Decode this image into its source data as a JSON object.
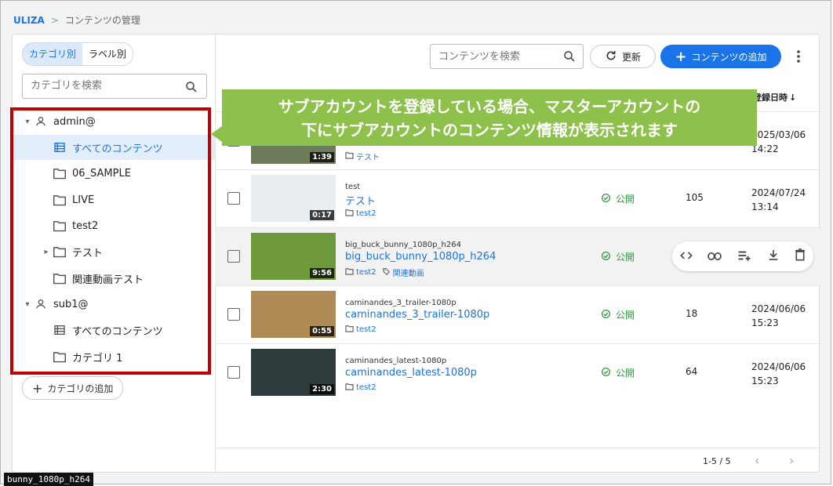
{
  "breadcrumb": {
    "home": "ULIZA",
    "separator": ">",
    "current": "コンテンツの管理"
  },
  "sidebar": {
    "toggle": [
      "カテゴリ別",
      "ラベル別"
    ],
    "search_placeholder": "カテゴリを検索",
    "tree": [
      {
        "label": "admin@",
        "icon": "person-icon",
        "level": 0,
        "arrow": "▾"
      },
      {
        "label": "すべてのコンテンツ",
        "icon": "list-icon",
        "level": 1,
        "selected": true
      },
      {
        "label": "06_SAMPLE",
        "icon": "folder-icon",
        "level": 1
      },
      {
        "label": "LIVE",
        "icon": "folder-icon",
        "level": 1
      },
      {
        "label": "test2",
        "icon": "folder-icon",
        "level": 1
      },
      {
        "label": "テスト",
        "icon": "folder-icon",
        "level": 1,
        "arrow": "▸"
      },
      {
        "label": "関連動画テスト",
        "icon": "folder-icon",
        "level": 1
      },
      {
        "label": "sub1@",
        "icon": "person-icon",
        "level": 0,
        "arrow": "▾"
      },
      {
        "label": "すべてのコンテンツ",
        "icon": "list-icon",
        "level": 1
      },
      {
        "label": "カテゴリ 1",
        "icon": "folder-icon",
        "level": 1
      }
    ],
    "add_category": "カテゴリの追加"
  },
  "toolbar": {
    "search_placeholder": "コンテンツを検索",
    "refresh": "更新",
    "add": "コンテンツの追加"
  },
  "column_header": "登録日時",
  "rows": [
    {
      "sub": "",
      "title": "",
      "duration": "1:39",
      "folders": [
        "テスト"
      ],
      "labels": [],
      "status": "",
      "count": "",
      "date1": "2025/03/06",
      "date2": "14:22",
      "thumb": "#6d7c5a"
    },
    {
      "sub": "test",
      "title": "テスト",
      "duration": "0:17",
      "folders": [
        "test2"
      ],
      "labels": [],
      "status": "公開",
      "count": "105",
      "date1": "2024/07/24",
      "date2": "13:14",
      "thumb": "#e9eef2"
    },
    {
      "sub": "big_buck_bunny_1080p_h264",
      "title": "big_buck_bunny_1080p_h264",
      "duration": "9:56",
      "folders": [
        "test2"
      ],
      "labels": [
        "関連動画"
      ],
      "status": "公開",
      "count": "",
      "date1": "",
      "date2": "",
      "thumb": "#6f9a3c",
      "hover": true
    },
    {
      "sub": "caminandes_3_trailer-1080p",
      "title": "caminandes_3_trailer-1080p",
      "duration": "0:55",
      "folders": [
        "test2"
      ],
      "labels": [],
      "status": "公開",
      "count": "18",
      "date1": "2024/06/06",
      "date2": "15:23",
      "thumb": "#b08a54"
    },
    {
      "sub": "caminandes_latest-1080p",
      "title": "caminandes_latest-1080p",
      "duration": "2:30",
      "folders": [
        "test2"
      ],
      "labels": [],
      "status": "公開",
      "count": "64",
      "date1": "2024/06/06",
      "date2": "15:23",
      "thumb": "#2f3a3c"
    }
  ],
  "row_actions": [
    "code-icon",
    "link-icon",
    "playlist-add-icon",
    "download-icon",
    "delete-icon"
  ],
  "pagination": {
    "range": "1-5 / 5"
  },
  "callout": {
    "line1": "サブアカウントを登録している場合、マスターアカウントの",
    "line2": "下にサブアカウントのコンテンツ情報が表示されます"
  },
  "tooltip": "bunny_1080p_h264",
  "colors": {
    "accent": "#1a73e8",
    "status_green": "#2e9d3e",
    "callout": "#8dc14b",
    "highlight_border": "#c00000"
  }
}
